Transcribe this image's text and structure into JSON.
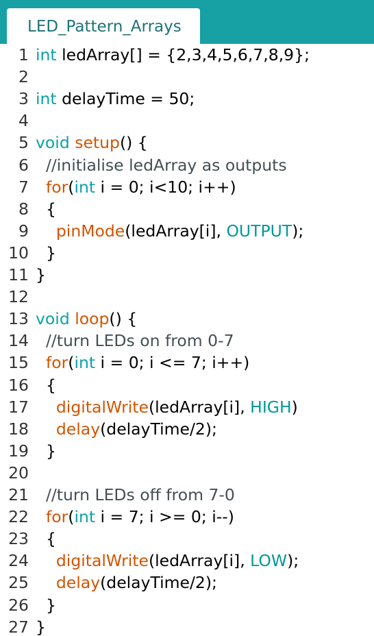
{
  "tab": {
    "title": "LED_Pattern_Arrays"
  },
  "colors": {
    "tab_bar": "#17a1a5",
    "keyword": "#0ca1a6",
    "function": "#d35400",
    "comment": "#434f54",
    "constant": "#00979c"
  },
  "code": {
    "lines": [
      {
        "n": "1",
        "tokens": [
          {
            "t": "int",
            "c": "kw"
          },
          {
            "t": " ledArray[] = {2,3,4,5,6,7,8,9};",
            "c": "txt"
          }
        ]
      },
      {
        "n": "2",
        "tokens": []
      },
      {
        "n": "3",
        "tokens": [
          {
            "t": "int",
            "c": "kw"
          },
          {
            "t": " delayTime = 50;",
            "c": "txt"
          }
        ]
      },
      {
        "n": "4",
        "tokens": []
      },
      {
        "n": "5",
        "tokens": [
          {
            "t": "void",
            "c": "kw"
          },
          {
            "t": " ",
            "c": "txt"
          },
          {
            "t": "setup",
            "c": "fn"
          },
          {
            "t": "() {",
            "c": "txt"
          }
        ]
      },
      {
        "n": "6",
        "tokens": [
          {
            "t": "  //initialise ledArray as outputs",
            "c": "cm"
          }
        ]
      },
      {
        "n": "7",
        "tokens": [
          {
            "t": "  ",
            "c": "txt"
          },
          {
            "t": "for",
            "c": "fn"
          },
          {
            "t": "(",
            "c": "txt"
          },
          {
            "t": "int",
            "c": "kw"
          },
          {
            "t": " i = 0; i<10; i++)",
            "c": "txt"
          }
        ]
      },
      {
        "n": "8",
        "tokens": [
          {
            "t": "  {",
            "c": "txt"
          }
        ]
      },
      {
        "n": "9",
        "tokens": [
          {
            "t": "    ",
            "c": "txt"
          },
          {
            "t": "pinMode",
            "c": "fn"
          },
          {
            "t": "(ledArray[i], ",
            "c": "txt"
          },
          {
            "t": "OUTPUT",
            "c": "const"
          },
          {
            "t": ");",
            "c": "txt"
          }
        ]
      },
      {
        "n": "10",
        "tokens": [
          {
            "t": "  }",
            "c": "txt"
          }
        ]
      },
      {
        "n": "11",
        "tokens": [
          {
            "t": "}",
            "c": "txt"
          }
        ]
      },
      {
        "n": "12",
        "tokens": []
      },
      {
        "n": "13",
        "tokens": [
          {
            "t": "void",
            "c": "kw"
          },
          {
            "t": " ",
            "c": "txt"
          },
          {
            "t": "loop",
            "c": "fn"
          },
          {
            "t": "() {",
            "c": "txt"
          }
        ]
      },
      {
        "n": "14",
        "tokens": [
          {
            "t": "  //turn LEDs on from 0-7",
            "c": "cm"
          }
        ]
      },
      {
        "n": "15",
        "tokens": [
          {
            "t": "  ",
            "c": "txt"
          },
          {
            "t": "for",
            "c": "fn"
          },
          {
            "t": "(",
            "c": "txt"
          },
          {
            "t": "int",
            "c": "kw"
          },
          {
            "t": " i = 0; i <= 7; i++)",
            "c": "txt"
          }
        ]
      },
      {
        "n": "16",
        "tokens": [
          {
            "t": "  {",
            "c": "txt"
          }
        ]
      },
      {
        "n": "17",
        "tokens": [
          {
            "t": "    ",
            "c": "txt"
          },
          {
            "t": "digitalWrite",
            "c": "fn"
          },
          {
            "t": "(ledArray[i], ",
            "c": "txt"
          },
          {
            "t": "HIGH",
            "c": "const"
          },
          {
            "t": ")",
            "c": "txt"
          }
        ]
      },
      {
        "n": "18",
        "tokens": [
          {
            "t": "    ",
            "c": "txt"
          },
          {
            "t": "delay",
            "c": "fn"
          },
          {
            "t": "(delayTime/2);",
            "c": "txt"
          }
        ]
      },
      {
        "n": "19",
        "tokens": [
          {
            "t": "  }",
            "c": "txt"
          }
        ]
      },
      {
        "n": "20",
        "tokens": []
      },
      {
        "n": "21",
        "tokens": [
          {
            "t": "  //turn LEDs off from 7-0",
            "c": "cm"
          }
        ]
      },
      {
        "n": "22",
        "tokens": [
          {
            "t": "  ",
            "c": "txt"
          },
          {
            "t": "for",
            "c": "fn"
          },
          {
            "t": "(",
            "c": "txt"
          },
          {
            "t": "int",
            "c": "kw"
          },
          {
            "t": " i = 7; i >= 0; i--)",
            "c": "txt"
          }
        ]
      },
      {
        "n": "23",
        "tokens": [
          {
            "t": "  {",
            "c": "txt"
          }
        ]
      },
      {
        "n": "24",
        "tokens": [
          {
            "t": "    ",
            "c": "txt"
          },
          {
            "t": "digitalWrite",
            "c": "fn"
          },
          {
            "t": "(ledArray[i], ",
            "c": "txt"
          },
          {
            "t": "LOW",
            "c": "const"
          },
          {
            "t": ");",
            "c": "txt"
          }
        ]
      },
      {
        "n": "25",
        "tokens": [
          {
            "t": "    ",
            "c": "txt"
          },
          {
            "t": "delay",
            "c": "fn"
          },
          {
            "t": "(delayTime/2);",
            "c": "txt"
          }
        ]
      },
      {
        "n": "26",
        "tokens": [
          {
            "t": "  }",
            "c": "txt"
          }
        ]
      },
      {
        "n": "27",
        "tokens": [
          {
            "t": "}",
            "c": "txt"
          }
        ]
      }
    ]
  }
}
